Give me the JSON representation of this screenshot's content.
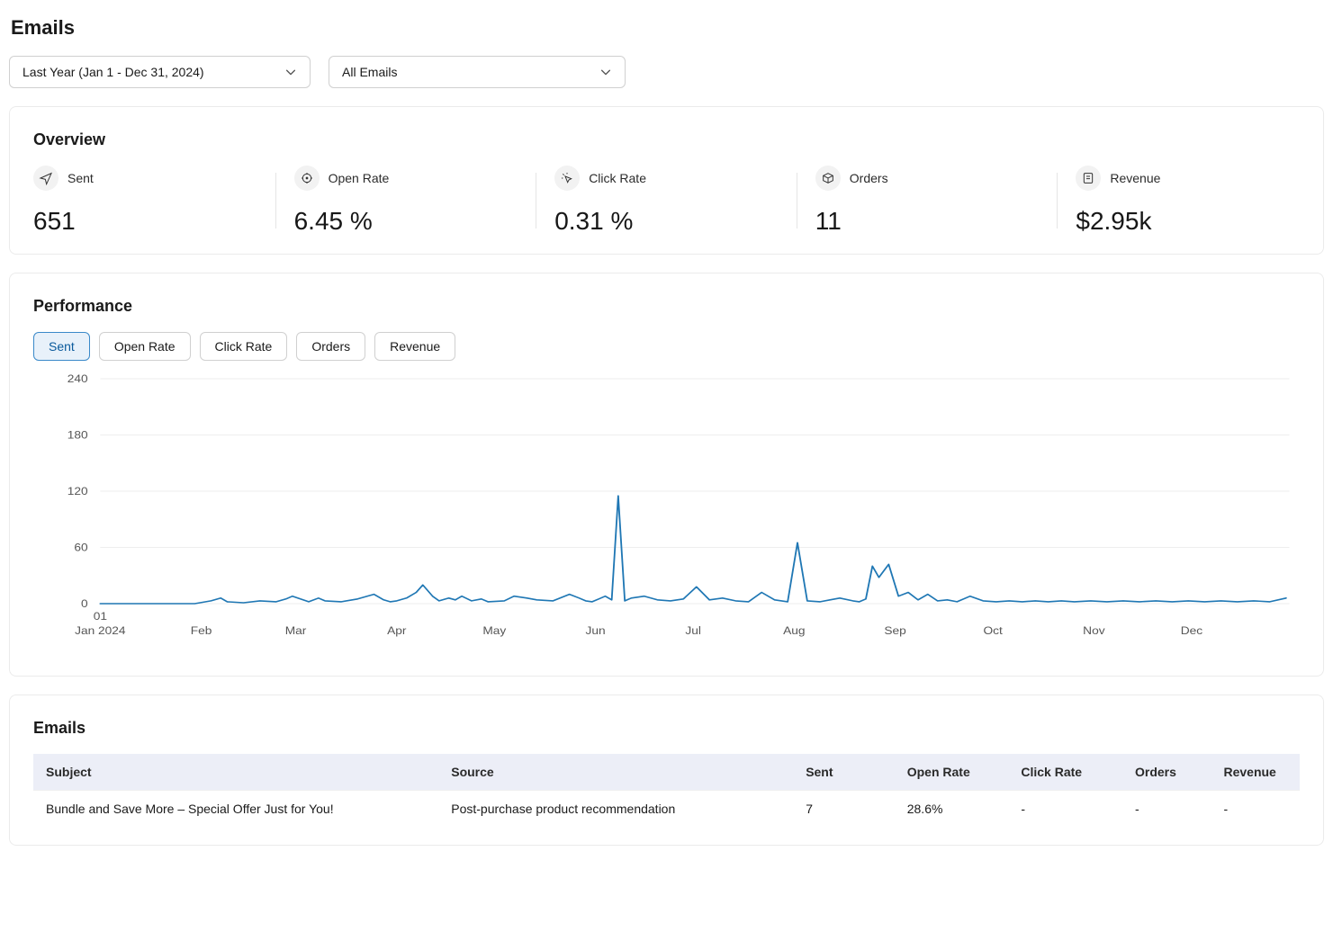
{
  "page_title": "Emails",
  "filters": {
    "date_range": "Last Year (Jan 1 - Dec 31, 2024)",
    "email_filter": "All Emails"
  },
  "overview": {
    "title": "Overview",
    "metrics": [
      {
        "key": "sent",
        "label": "Sent",
        "value": "651",
        "icon": "send-icon"
      },
      {
        "key": "open_rate",
        "label": "Open Rate",
        "value": "6.45 %",
        "icon": "open-icon"
      },
      {
        "key": "click_rate",
        "label": "Click Rate",
        "value": "0.31 %",
        "icon": "click-icon"
      },
      {
        "key": "orders",
        "label": "Orders",
        "value": "11",
        "icon": "orders-icon"
      },
      {
        "key": "revenue",
        "label": "Revenue",
        "value": "$2.95k",
        "icon": "revenue-icon"
      }
    ]
  },
  "performance": {
    "title": "Performance",
    "tabs": [
      "Sent",
      "Open Rate",
      "Click Rate",
      "Orders",
      "Revenue"
    ],
    "active_tab": "Sent"
  },
  "chart_data": {
    "type": "line",
    "title": "",
    "xlabel": "",
    "ylabel": "",
    "ylim": [
      0,
      240
    ],
    "y_ticks": [
      0,
      60,
      120,
      180,
      240
    ],
    "x_range_days": 366,
    "x_tick_labels": [
      "01",
      "Jan 2024",
      "Feb",
      "Mar",
      "Apr",
      "May",
      "Jun",
      "Jul",
      "Aug",
      "Sep",
      "Oct",
      "Nov",
      "Dec"
    ],
    "x_tick_positions": [
      1,
      1,
      32,
      61,
      92,
      122,
      153,
      183,
      214,
      245,
      275,
      306,
      336
    ],
    "series": [
      {
        "name": "Sent",
        "x_days": [
          1,
          5,
          10,
          15,
          20,
          25,
          30,
          35,
          38,
          40,
          45,
          50,
          55,
          58,
          60,
          65,
          68,
          70,
          75,
          80,
          85,
          88,
          90,
          92,
          95,
          98,
          100,
          103,
          105,
          108,
          110,
          112,
          115,
          118,
          120,
          125,
          128,
          132,
          135,
          140,
          145,
          148,
          150,
          152,
          154,
          156,
          158,
          160,
          162,
          164,
          168,
          172,
          176,
          180,
          184,
          188,
          192,
          196,
          200,
          204,
          208,
          212,
          215,
          218,
          222,
          225,
          228,
          232,
          234,
          236,
          238,
          240,
          243,
          246,
          249,
          252,
          255,
          258,
          261,
          264,
          268,
          272,
          276,
          280,
          284,
          288,
          292,
          296,
          300,
          305,
          310,
          315,
          320,
          325,
          330,
          335,
          340,
          345,
          350,
          355,
          360,
          365
        ],
        "values": [
          0,
          0,
          0,
          0,
          0,
          0,
          0,
          3,
          6,
          2,
          1,
          3,
          2,
          5,
          8,
          2,
          6,
          3,
          2,
          5,
          10,
          4,
          2,
          3,
          6,
          12,
          20,
          8,
          3,
          6,
          4,
          8,
          3,
          5,
          2,
          3,
          8,
          6,
          4,
          3,
          10,
          6,
          3,
          2,
          5,
          8,
          4,
          115,
          3,
          6,
          8,
          4,
          3,
          5,
          18,
          4,
          6,
          3,
          2,
          12,
          4,
          2,
          65,
          3,
          2,
          4,
          6,
          3,
          2,
          5,
          40,
          28,
          42,
          8,
          12,
          4,
          10,
          3,
          4,
          2,
          8,
          3,
          2,
          3,
          2,
          3,
          2,
          3,
          2,
          3,
          2,
          3,
          2,
          3,
          2,
          3,
          2,
          3,
          2,
          3,
          2,
          6
        ]
      }
    ]
  },
  "emails_table": {
    "title": "Emails",
    "columns": [
      "Subject",
      "Source",
      "Sent",
      "Open Rate",
      "Click Rate",
      "Orders",
      "Revenue"
    ],
    "rows": [
      {
        "subject": "Bundle and Save More – Special Offer Just for You!",
        "source": "Post-purchase product recommendation",
        "sent": "7",
        "open_rate": "28.6%",
        "click_rate": "-",
        "orders": "-",
        "revenue": "-"
      }
    ]
  }
}
